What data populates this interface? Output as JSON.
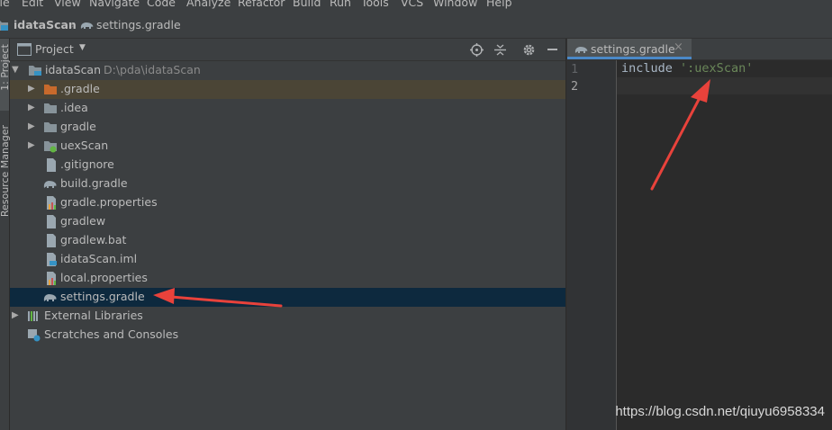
{
  "menu": {
    "items": [
      "ile",
      "Edit",
      "View",
      "Navigate",
      "Code",
      "Analyze",
      "Refactor",
      "Build",
      "Run",
      "Tools",
      "VCS",
      "Window",
      "Help"
    ]
  },
  "breadcrumb": {
    "project": "idataScan",
    "file": "settings.gradle"
  },
  "side_tabs": {
    "project": "1: Project",
    "resource": "Resource Manager"
  },
  "project_panel": {
    "title": "Project",
    "tree": [
      {
        "label": "idataScan",
        "path": "D:\\pda\\idataScan",
        "icon": "module-folder-icon",
        "arrow": "expanded"
      },
      {
        "label": ".gradle",
        "icon": "orange-folder-icon",
        "arrow": "collapsed"
      },
      {
        "label": ".idea",
        "icon": "folder-icon",
        "arrow": "collapsed"
      },
      {
        "label": "gradle",
        "icon": "folder-icon",
        "arrow": "collapsed"
      },
      {
        "label": "uexScan",
        "icon": "module-folder-icon",
        "arrow": "collapsed"
      },
      {
        "label": ".gitignore",
        "icon": "text-file-icon",
        "arrow": "none"
      },
      {
        "label": "build.gradle",
        "icon": "gradle-elephant-icon",
        "arrow": "none"
      },
      {
        "label": "gradle.properties",
        "icon": "properties-file-icon",
        "arrow": "none"
      },
      {
        "label": "gradlew",
        "icon": "text-file-icon",
        "arrow": "none"
      },
      {
        "label": "gradlew.bat",
        "icon": "text-file-icon",
        "arrow": "none"
      },
      {
        "label": "idataScan.iml",
        "icon": "iml-file-icon",
        "arrow": "none"
      },
      {
        "label": "local.properties",
        "icon": "properties-file-icon",
        "arrow": "none"
      },
      {
        "label": "settings.gradle",
        "icon": "gradle-elephant-icon",
        "arrow": "none",
        "selected": true
      },
      {
        "label": "External Libraries",
        "icon": "libraries-icon",
        "arrow": "collapsed"
      },
      {
        "label": "Scratches and Consoles",
        "icon": "scratches-icon",
        "arrow": "none"
      }
    ]
  },
  "editor": {
    "tab": "settings.gradle",
    "lines": [
      {
        "number": "1",
        "keyword": "include",
        "string": "':uexScan'"
      },
      {
        "number": "2",
        "keyword": "",
        "string": ""
      }
    ]
  },
  "watermark": "https://blog.csdn.net/qiuyu6958334",
  "colors": {
    "selection": "#0d293e",
    "highlighted_row": "#4b4536",
    "arrow": "#e8423b",
    "string": "#6a8759",
    "keyword": "#a9b7c6"
  }
}
